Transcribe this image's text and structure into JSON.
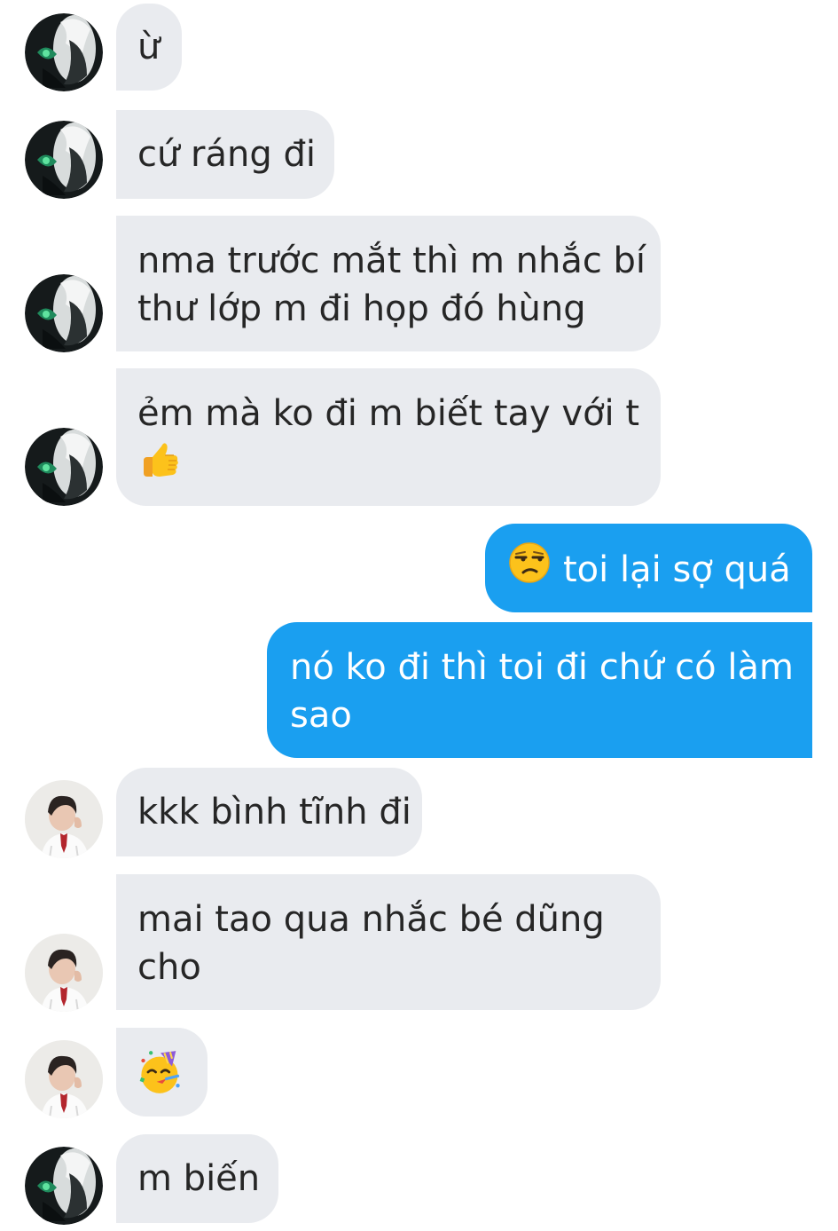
{
  "messages": [
    {
      "sender": "contact_a",
      "lines": [
        "ừ"
      ]
    },
    {
      "sender": "contact_a",
      "lines": [
        "cứ ráng đi"
      ]
    },
    {
      "sender": "contact_a",
      "lines": [
        "nma trước mắt thì m nhắc bí",
        "thư lớp m đi họp đó hùng"
      ]
    },
    {
      "sender": "contact_a",
      "lines": [
        "ẻm mà ko đi m biết tay với t"
      ],
      "emoji": "thumbs-up"
    },
    {
      "sender": "me",
      "text": "toi lại sợ quá",
      "emoji": "unamused-face"
    },
    {
      "sender": "me",
      "lines": [
        "nó ko đi thì toi đi chứ có làm",
        "sao"
      ]
    },
    {
      "sender": "contact_b",
      "lines": [
        "kkk bình tĩnh đi"
      ]
    },
    {
      "sender": "contact_b",
      "lines": [
        "mai tao qua nhắc bé dũng",
        "cho"
      ]
    },
    {
      "sender": "contact_b",
      "emoji": "partying-face"
    },
    {
      "sender": "contact_a",
      "lines": [
        "m biến"
      ]
    }
  ],
  "colors": {
    "incoming_bubble": "#e9ebef",
    "outgoing_bubble": "#1a9ff0",
    "incoming_text": "#262626",
    "outgoing_text": "#ffffff"
  }
}
